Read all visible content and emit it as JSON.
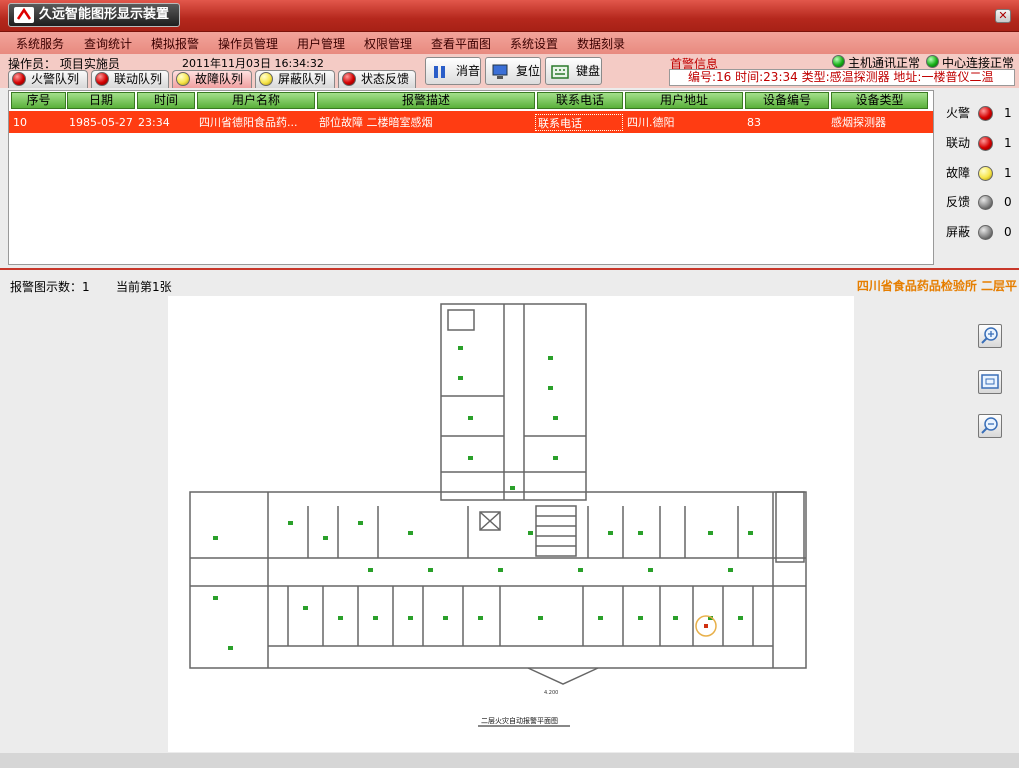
{
  "app": {
    "title": "久远智能图形显示装置"
  },
  "menu": [
    "系统服务",
    "查询统计",
    "模拟报警",
    "操作员管理",
    "用户管理",
    "权限管理",
    "查看平面图",
    "系统设置",
    "数据刻录"
  ],
  "operator": {
    "label": "操作员：",
    "name": "项目实施员"
  },
  "datetime": "2011年11月03日  16:34:32",
  "queue_tabs": [
    {
      "label": "火警队列",
      "color": "red"
    },
    {
      "label": "联动队列",
      "color": "red"
    },
    {
      "label": "故障队列",
      "color": "yellow"
    },
    {
      "label": "屏蔽队列",
      "color": "yellow"
    },
    {
      "label": "状态反馈",
      "color": "red"
    }
  ],
  "toolbar": {
    "mute": "消音",
    "reset": "复位",
    "keyboard": "键盘"
  },
  "first_alarm": {
    "label": "首警信息",
    "text": "编号:16 时间:23:34 类型:感温探测器 地址:一楼普仪二温"
  },
  "connection": {
    "host": "主机通讯正常",
    "center": "中心连接正常"
  },
  "table": {
    "columns": [
      "序号",
      "日期",
      "时间",
      "用户名称",
      "报警描述",
      "联系电话",
      "用户地址",
      "设备编号",
      "设备类型"
    ],
    "rows": [
      {
        "seq": "10",
        "date": "1985-05-27",
        "time": "23:34",
        "user": "四川省德阳食品药...",
        "desc": "部位故障  二楼暗室感烟",
        "phone": "联系电话",
        "addr": "四川.德阳",
        "device_no": "83",
        "device_type": "感烟探测器"
      }
    ]
  },
  "status_counts": [
    {
      "label": "火警",
      "count": "1",
      "color": "red"
    },
    {
      "label": "联动",
      "count": "1",
      "color": "red"
    },
    {
      "label": "故障",
      "count": "1",
      "color": "yellow"
    },
    {
      "label": "反馈",
      "count": "0",
      "color": "grey"
    },
    {
      "label": "屏蔽",
      "count": "0",
      "color": "grey"
    }
  ],
  "plan": {
    "count_label": "报警图示数：1",
    "current_label": "当前第1张",
    "title": "四川省食品药品检验所  二层平",
    "caption": "二层火灾自动报警平面图",
    "dimension": "4.200"
  },
  "colors": {
    "titlebar": "#b5281d",
    "menubar": "#ec9186",
    "alarm_row": "#ff3c12",
    "header_green": "#5ab03a",
    "plan_title": "#e67e00"
  }
}
